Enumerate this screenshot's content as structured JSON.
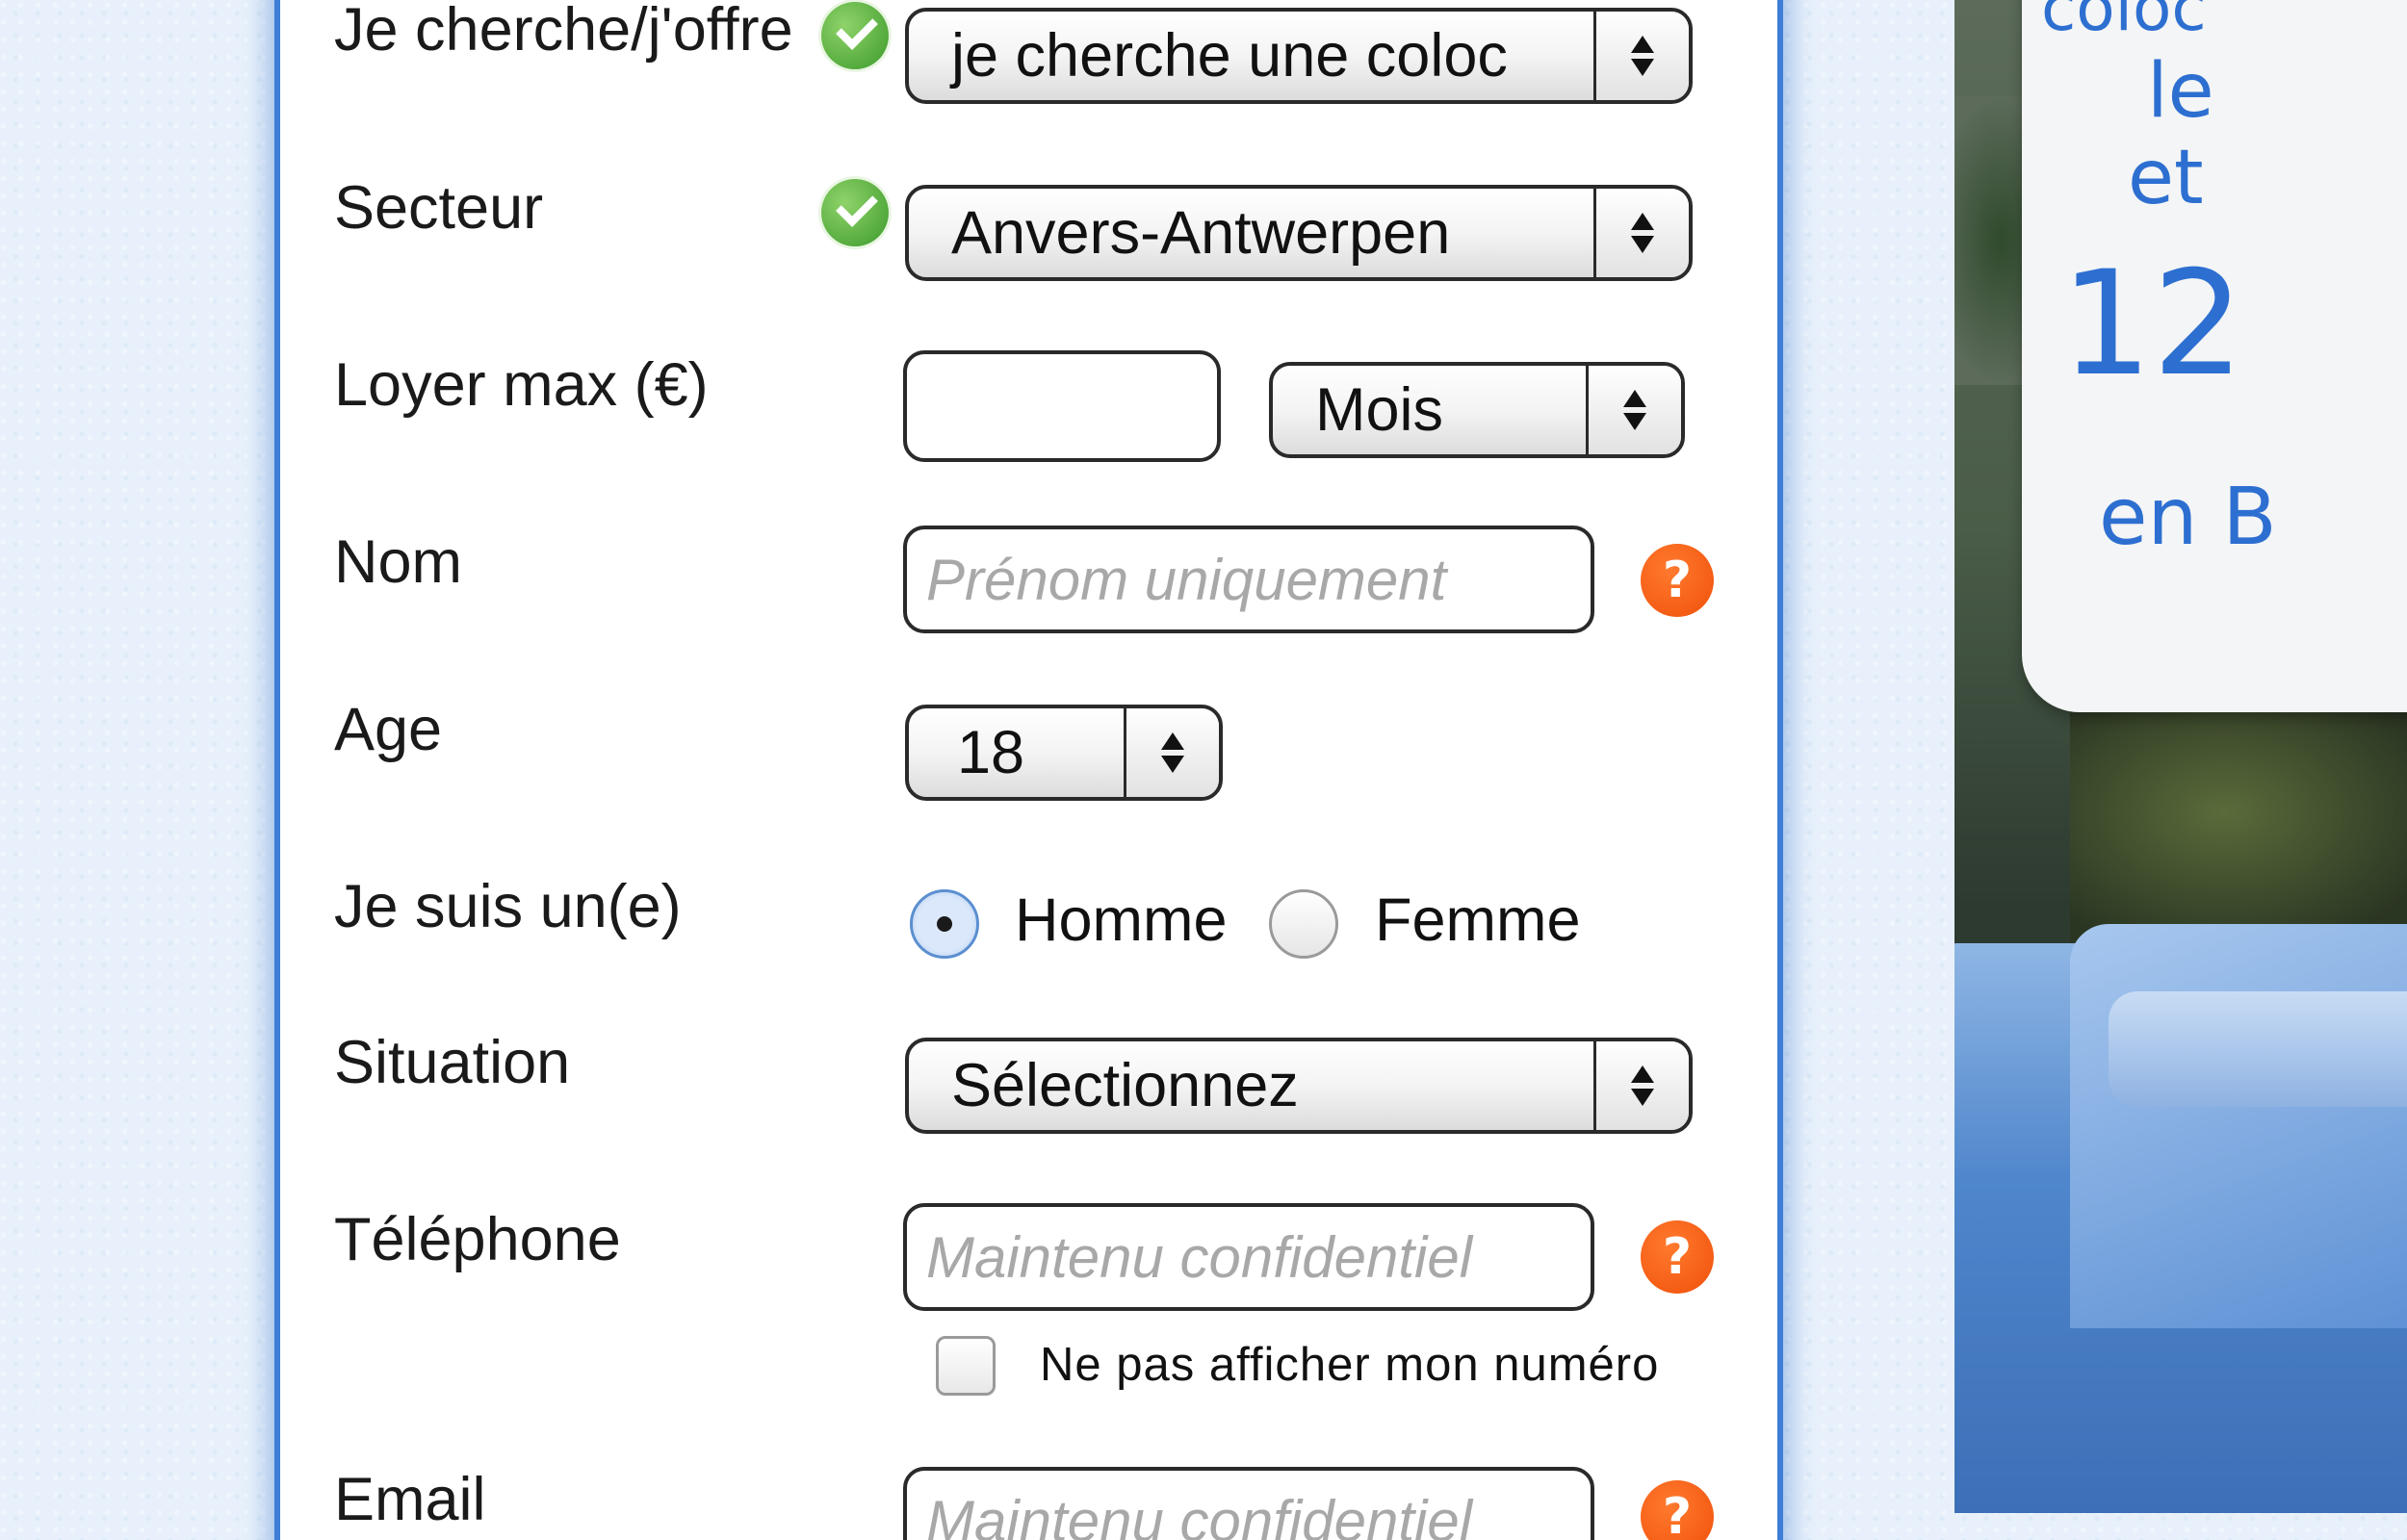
{
  "form": {
    "seek_offer": {
      "label": "Je cherche/j'offre",
      "value": "je cherche une coloc"
    },
    "sector": {
      "label": "Secteur",
      "value": "Anvers-Antwerpen"
    },
    "rent": {
      "label": "Loyer max (€)",
      "value": "",
      "period": "Mois"
    },
    "name": {
      "label": "Nom",
      "placeholder": "Prénom uniquement",
      "help": "?"
    },
    "age": {
      "label": "Age",
      "value": "18"
    },
    "gender": {
      "label": "Je suis un(e)",
      "options": [
        "Homme",
        "Femme"
      ],
      "selected": "Homme"
    },
    "situation": {
      "label": "Situation",
      "value": "Sélectionnez"
    },
    "phone": {
      "label": "Téléphone",
      "placeholder": "Maintenu confidentiel",
      "help": "?",
      "hide_number_label": "Ne pas afficher mon numéro"
    },
    "email": {
      "label": "Email",
      "placeholder": "Maintenu confidentiel",
      "help": "?"
    }
  },
  "promo": {
    "lines": [
      "coloc",
      "le",
      "et",
      "12",
      "en B"
    ]
  },
  "colors": {
    "accent_border": "#3d7ed6",
    "valid_icon": "#3c9a2a",
    "help_icon": "#f0500a",
    "promo_text": "#2d6fd1"
  },
  "icons": [
    "check-icon",
    "help-icon",
    "select-arrows-icon"
  ]
}
